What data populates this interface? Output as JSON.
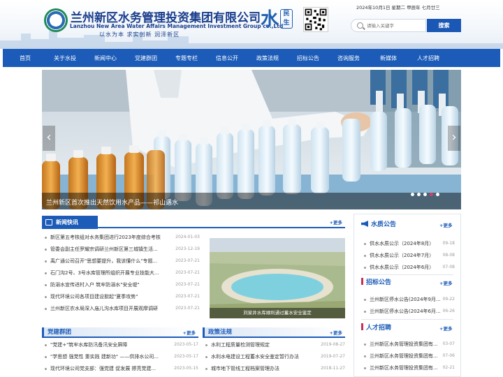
{
  "header": {
    "org_name_cn": "兰州新区水务管理投资集团有限公司",
    "org_name_en": "Lanzhou New Area Water Affairs Management Investment Group co.,Ltd",
    "slogan": "以水为本  求实创新  润泽新区",
    "date": "2024年10月1日 星期二 甲辰年 七月廿三",
    "search": {
      "placeholder": "请输入关键字",
      "button_label": "搜索"
    }
  },
  "nav": {
    "items": [
      "首页",
      "关于水投",
      "新闻中心",
      "党建群团",
      "专题专栏",
      "信息公开",
      "政策法规",
      "招标公告",
      "咨询服务",
      "新媒体",
      "人才招聘"
    ]
  },
  "slider": {
    "caption": "兰州新区首次推出天然饮用水产品——祁山遇水",
    "dot_count": 5,
    "active_dot": 3
  },
  "news": {
    "title": "新闻快讯",
    "more_label": "+更多",
    "items": [
      {
        "title": "新区第五考核组对水务集团进行2023年度综合考核",
        "date": "2024-01-03"
      },
      {
        "title": "管委会副主任罗耀宗调研兰州新区第三城镇生活...",
        "date": "2023-12-19"
      },
      {
        "title": "禹广通公司召开\"思想要提升，我该懂什么\"专题...",
        "date": "2023-07-21"
      },
      {
        "title": "石门沟2号、3号水库管理所组织开展专业技能大...",
        "date": "2023-07-21"
      },
      {
        "title": "防溺水宣传进村入户 筑牢防溺水\"安全堤\"",
        "date": "2023-07-21"
      },
      {
        "title": "现代环境公司各项目建设掀起\"夏季攻势\"",
        "date": "2023-07-21"
      },
      {
        "title": "兰州新区农水局深入庙儿沟水库项目开展观摩调研",
        "date": "2023-07-21"
      }
    ],
    "photo_caption": "刘家井水库顺利通过蓄水安全鉴定"
  },
  "water_quality": {
    "title": "水质公告",
    "more_label": "+更多",
    "items": [
      {
        "title": "供水水质公示（2024年8月）",
        "date": "09-18"
      },
      {
        "title": "供水水质公示（2024年7月）",
        "date": "08-08"
      },
      {
        "title": "供水水质公示（2024年6月）",
        "date": "07-08"
      }
    ]
  },
  "bidding": {
    "title": "招标公告",
    "more_label": "+更多",
    "items": [
      {
        "title": "兰州新区停水公告(2024年9月...",
        "date": "09-22"
      },
      {
        "title": "兰州新区停水公告(2024年6月...",
        "date": "06-26"
      }
    ]
  },
  "recruit": {
    "title": "人才招聘",
    "more_label": "+更多",
    "items": [
      {
        "title": "兰州新区水务管理投资集团有...",
        "date": "03-07"
      },
      {
        "title": "兰州新区水务管理投资集团有...",
        "date": "07-06"
      },
      {
        "title": "兰州新区水务管理投资集团有...",
        "date": "02-21"
      }
    ]
  },
  "party": {
    "title": "党建群团",
    "more_label": "+更多",
    "items": [
      {
        "title": "\"党建+\"筑牢水库防汛备汛安全屏障",
        "date": "2023-05-17"
      },
      {
        "title": "\"学思想 强党性 重实践 建新功\" ——供排水公司...",
        "date": "2023-05-17"
      },
      {
        "title": "现代环境公司党支部：强党建 促发展 擦亮党建...",
        "date": "2023-05-15"
      }
    ]
  },
  "policy": {
    "title": "政策法规",
    "more_label": "+更多",
    "items": [
      {
        "title": "水利工程质量检测管理规定",
        "date": "2019-08-27"
      },
      {
        "title": "水利水电建设工程蓄水安全鉴定暂行办法",
        "date": "2019-07-27"
      },
      {
        "title": "城市地下管线工程档案管理办法",
        "date": "2018-11-27"
      }
    ]
  },
  "colors": {
    "brand_blue": "#1c5cb8",
    "accent_red": "#c62f5b"
  }
}
